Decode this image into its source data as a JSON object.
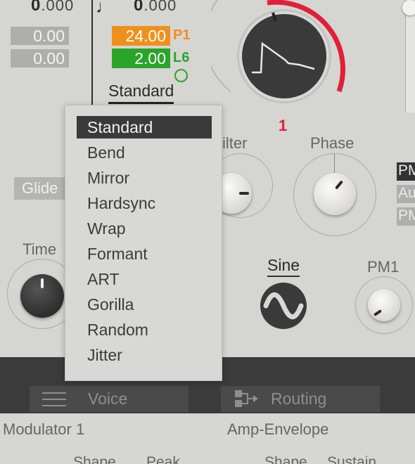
{
  "top_left": {
    "value_main": "0",
    "value_frac": ".000",
    "boxes": [
      "0.00",
      "0.00"
    ]
  },
  "top_mid": {
    "note_glyph": "♩",
    "value_main": "0",
    "value_frac": ".000",
    "tag1_value": "24.00",
    "tag1_label": "P1",
    "tag2_value": "2.00",
    "tag2_label": "L6",
    "mode_label": "Standard"
  },
  "wave_display": {
    "index": "1"
  },
  "labels": {
    "glide": "Glide",
    "time": "Time",
    "filter": "ilter",
    "phase": "Phase",
    "wave": "Sine",
    "pm1": "PM1",
    "right_pm": "PM",
    "right_au": "Au",
    "right_pm2": "PM"
  },
  "menu": {
    "items": [
      "Standard",
      "Bend",
      "Mirror",
      "Hardsync",
      "Wrap",
      "Formant",
      "ART",
      "Gorilla",
      "Random",
      "Jitter"
    ],
    "selected": 0
  },
  "tabs": {
    "voice": "Voice",
    "routing": "Routing"
  },
  "footer": {
    "modulator": "Modulator 1",
    "amp_env": "Amp-Envelope",
    "shape1": "Shape",
    "peak": "Peak",
    "shape2": "Shape",
    "sustain": "Sustain"
  },
  "colors": {
    "orange": "#f0901c",
    "green": "#2aa52a",
    "red": "#e0203a",
    "menu_selected": "#3a3a3a"
  }
}
